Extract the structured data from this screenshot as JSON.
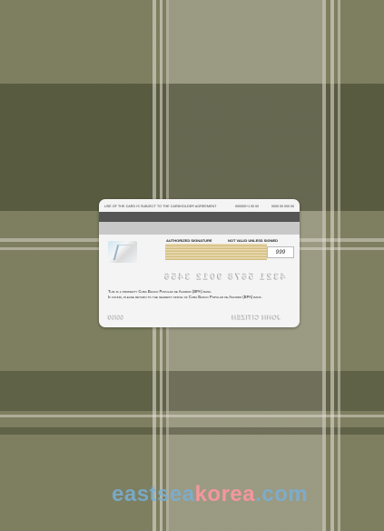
{
  "card": {
    "top_text": "USE OF THE CARD IS SUBJECT TO THE CARDHOLDER AGREEMENT",
    "code1": "000000+1 00 00",
    "code2": "0000 00 000 00",
    "auth_label": "AUTHORIZED SIGNATURE",
    "valid_label": "NOT VALID UNLESS SIGNED",
    "cvv": "999",
    "number": "4321 5678 9012 3456",
    "issuer_line1": "This is a property Cuba Banco Popular de Ahorro (BPA) bank.",
    "issuer_line2": "If found, please return to the nearest office of Cuba Banco Popular de Ahorro (BPA) bank.",
    "expiry": "00/00",
    "holder": "JOHN CITIZEN"
  },
  "watermark": {
    "part_a": "eastsea",
    "part_b": "korea",
    "part_c": ".com"
  },
  "colors": {
    "fabric": "#7d7f60",
    "card": "#f4f4f4",
    "stripe": "#555555",
    "signature": "#e9dcb4"
  }
}
